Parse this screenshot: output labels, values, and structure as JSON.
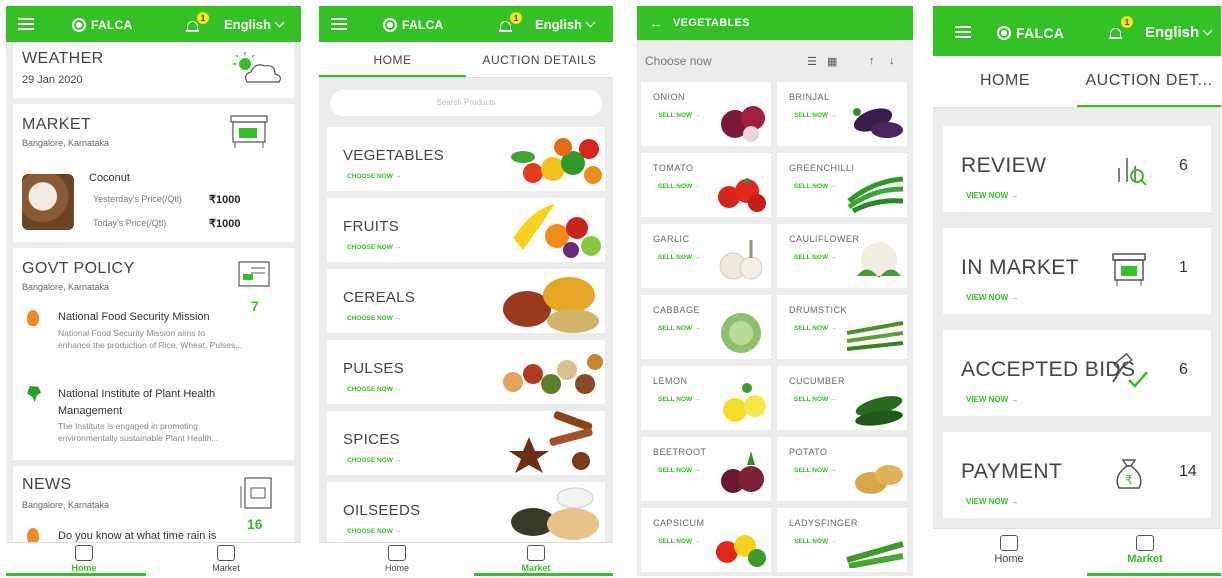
{
  "app": {
    "brand": "FALCA",
    "language": "English",
    "notification_count": "1"
  },
  "screen1": {
    "weather": {
      "title": "WEATHER",
      "date": "29 Jan 2020",
      "icon": "sun-cloud-icon"
    },
    "market": {
      "title": "MARKET",
      "location": "Bangalore, Karnataka",
      "commodity": "Coconut",
      "yesterday_label": "Yesterday's Price(/Qtl)",
      "yesterday_price": "₹1000",
      "today_label": "Today's Price(/Qtl)",
      "today_price": "₹1000"
    },
    "govt_policy": {
      "title": "GOVT POLICY",
      "location": "Bangalore, Karnataka",
      "count": "7",
      "items": [
        {
          "title": "National Food Security Mission",
          "desc1": "National Food Security Mission aims to",
          "desc2": "enhance the production of Rice, Wheat, Pulses..."
        },
        {
          "title1": "National Institute of Plant Health",
          "title2": "Management",
          "desc1": "The Institute is engaged in promoting",
          "desc2": "environmentally sustainable Plant Health..."
        }
      ]
    },
    "news": {
      "title": "NEWS",
      "location": "Bangalore, Karnataka",
      "count": "16",
      "item1": "Do you know at what time rain is"
    },
    "nav": {
      "home": "Home",
      "market": "Market"
    }
  },
  "screen2": {
    "tabs": {
      "home": "HOME",
      "auction": "AUCTION DETAILS"
    },
    "search_placeholder": "Search Products",
    "categories": [
      {
        "name": "VEGETABLES",
        "cta": "CHOOSE NOW →"
      },
      {
        "name": "FRUITS",
        "cta": "CHOOSE NOW →"
      },
      {
        "name": "CEREALS",
        "cta": "CHOOSE NOW →"
      },
      {
        "name": "PULSES",
        "cta": "CHOOSE NOW →"
      },
      {
        "name": "SPICES",
        "cta": "CHOOSE NOW →"
      },
      {
        "name": "OILSEEDS",
        "cta": "CHOOSE NOW →"
      }
    ],
    "nav": {
      "home": "Home",
      "market": "Market"
    }
  },
  "screen3": {
    "title": "VEGETABLES",
    "choose": "Choose now",
    "items": [
      {
        "name": "ONION",
        "cta": "SELL NOW →"
      },
      {
        "name": "BRINJAL",
        "cta": "SELL NOW →"
      },
      {
        "name": "TOMATO",
        "cta": "SELL NOW →"
      },
      {
        "name": "GREENCHILLI",
        "cta": "SELL NOW →"
      },
      {
        "name": "GARLIC",
        "cta": "SELL NOW →"
      },
      {
        "name": "CAULIFLOWER",
        "cta": "SELL NOW →"
      },
      {
        "name": "CABBAGE",
        "cta": "SELL NOW →"
      },
      {
        "name": "DRUMSTICK",
        "cta": "SELL NOW →"
      },
      {
        "name": "LEMON",
        "cta": "SELL NOW →"
      },
      {
        "name": "CUCUMBER",
        "cta": "SELL NOW →"
      },
      {
        "name": "BEETROOT",
        "cta": "SELL NOW →"
      },
      {
        "name": "POTATO",
        "cta": "SELL NOW →"
      },
      {
        "name": "CAPSICUM",
        "cta": "SELL NOW →"
      },
      {
        "name": "LADYSFINGER",
        "cta": "SELL NOW →"
      }
    ]
  },
  "screen4": {
    "tabs": {
      "home": "HOME",
      "auction": "AUCTION DET..."
    },
    "cards": [
      {
        "title": "REVIEW",
        "cta": "VIEW NOW →",
        "count": "6"
      },
      {
        "title": "IN MARKET",
        "cta": "VIEW NOW →",
        "count": "1"
      },
      {
        "title": "ACCEPTED BIDS",
        "cta": "VIEW NOW →",
        "count": "6"
      },
      {
        "title": "PAYMENT",
        "cta": "VIEW NOW →",
        "count": "14"
      }
    ],
    "nav": {
      "home": "Home",
      "market": "Market"
    }
  },
  "colors": {
    "accent": "#34c126",
    "badge": "#f5e612"
  }
}
